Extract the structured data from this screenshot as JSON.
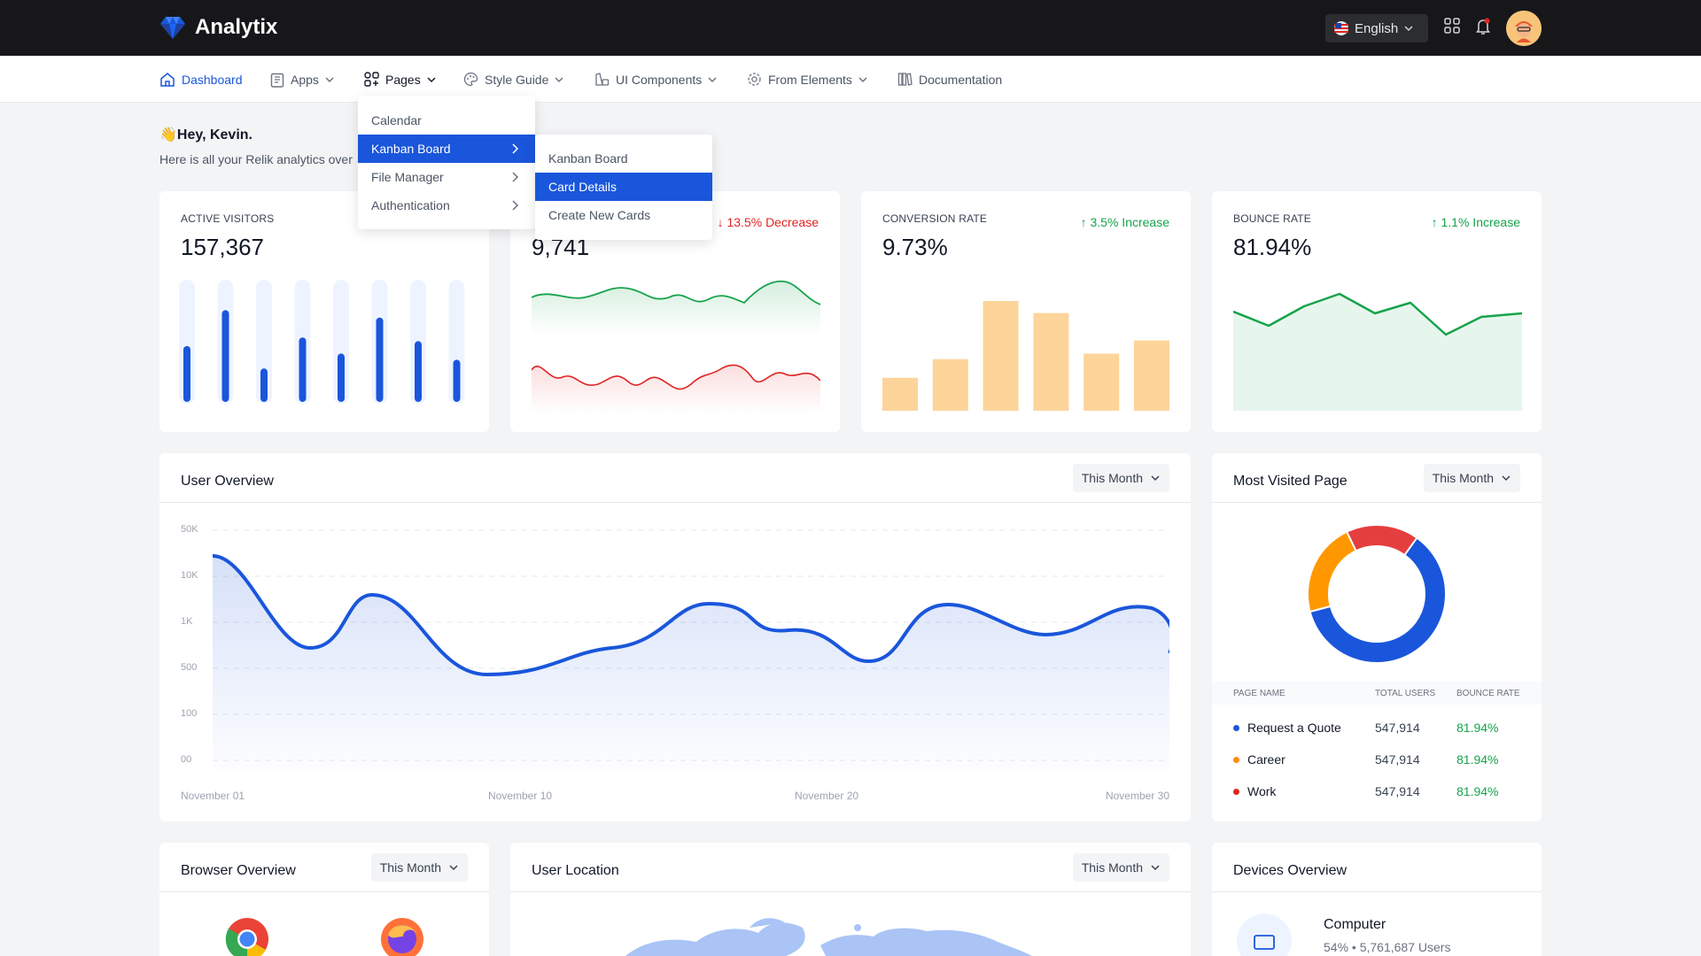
{
  "app": {
    "title": "Analytix"
  },
  "header": {
    "language": "English"
  },
  "nav": {
    "items": [
      {
        "label": "Dashboard"
      },
      {
        "label": "Apps"
      },
      {
        "label": "Pages"
      },
      {
        "label": "Style Guide"
      },
      {
        "label": "UI Components"
      },
      {
        "label": "From Elements"
      },
      {
        "label": "Documentation"
      }
    ]
  },
  "pages_menu": {
    "items": [
      {
        "label": "Calendar"
      },
      {
        "label": "Kanban Board"
      },
      {
        "label": "File Manager"
      },
      {
        "label": "Authentication"
      }
    ],
    "selected": "Kanban Board"
  },
  "kanban_submenu": {
    "items": [
      {
        "label": "Kanban Board"
      },
      {
        "label": "Card Details"
      },
      {
        "label": "Create New Cards"
      }
    ],
    "selected": "Card Details"
  },
  "greeting": {
    "emoji": "👋",
    "title": "Hey, Kevin.",
    "subtitle": "Here is all your Relik analytics over"
  },
  "stats": [
    {
      "label": "ACTIVE VISITORS",
      "value": "157,367",
      "trend": ""
    },
    {
      "label": "",
      "value": "9,741",
      "trend": "13.5% Decrease",
      "direction": "down"
    },
    {
      "label": "CONVERSION RATE",
      "value": "9.73%",
      "trend": "3.5% Increase",
      "direction": "up"
    },
    {
      "label": "BOUNCE RATE",
      "value": "81.94%",
      "trend": "1.1% Increase",
      "direction": "up"
    }
  ],
  "active_visitors_bars": [
    0.45,
    0.74,
    0.27,
    0.52,
    0.39,
    0.68,
    0.49,
    0.34
  ],
  "conversion_bars": [
    0.3,
    0.47,
    1.0,
    0.89,
    0.52,
    0.64
  ],
  "user_overview": {
    "title": "User Overview",
    "filter": "This Month",
    "y_ticks": [
      "50K",
      "10K",
      "1K",
      "500",
      "100",
      "00"
    ],
    "x_ticks": [
      "November 01",
      "November 10",
      "November 20",
      "November 30"
    ]
  },
  "most_visited": {
    "title": "Most Visited Page",
    "filter": "This Month",
    "columns": [
      "PAGE NAME",
      "TOTAL USERS",
      "BOUNCE RATE"
    ],
    "rows": [
      {
        "name": "Request a Quote",
        "users": "547,914",
        "bounce": "81.94%",
        "color": "#1a56db"
      },
      {
        "name": "Career",
        "users": "547,914",
        "bounce": "81.94%",
        "color": "#ff8a00"
      },
      {
        "name": "Work",
        "users": "547,914",
        "bounce": "81.94%",
        "color": "#e02424"
      }
    ],
    "donut": [
      {
        "color": "#1a56db",
        "fraction": 0.61
      },
      {
        "color": "#ff9800",
        "fraction": 0.22
      },
      {
        "color": "#e53e3e",
        "fraction": 0.17
      }
    ]
  },
  "browser_overview": {
    "title": "Browser Overview",
    "filter": "This Month"
  },
  "user_location": {
    "title": "User Location",
    "filter": "This Month"
  },
  "devices_overview": {
    "title": "Devices Overview",
    "device": "Computer",
    "percent": "54%",
    "users": "5,761,687 Users"
  },
  "colors": {
    "primary": "#1a56db",
    "green": "#16a34a",
    "red": "#e02424",
    "orange": "#fdd49a"
  }
}
